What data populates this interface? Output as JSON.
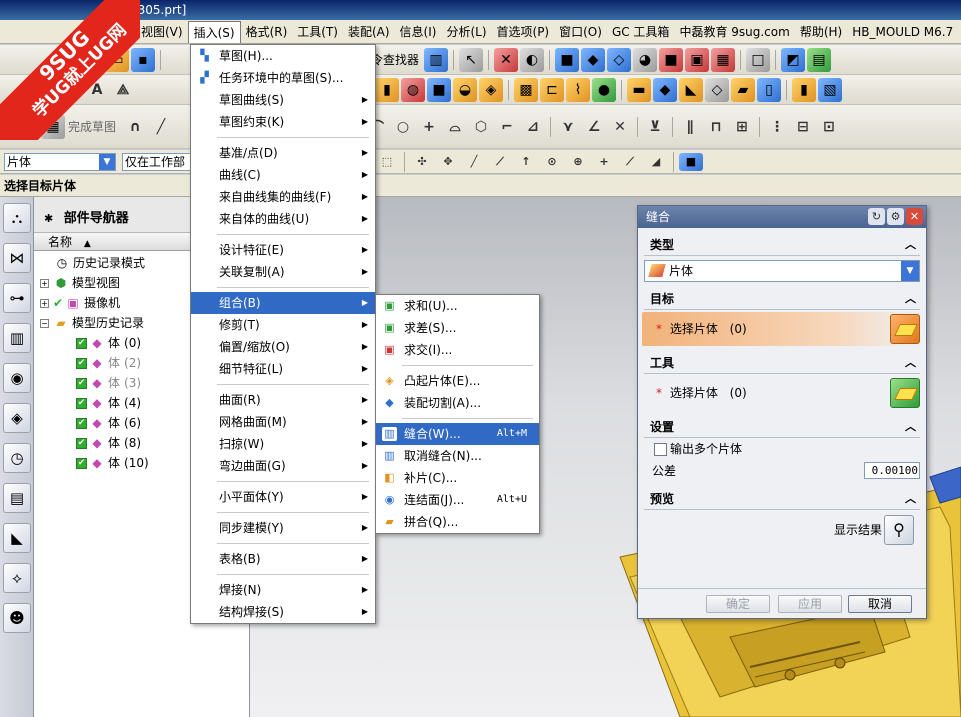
{
  "window": {
    "title_fragment": "0305.prt]"
  },
  "watermark": {
    "line1": "9SUG",
    "line2": "学UG就上UG网"
  },
  "menubar": {
    "items": [
      "视图(V)",
      "插入(S)",
      "格式(R)",
      "工具(T)",
      "装配(A)",
      "信息(I)",
      "分析(L)",
      "首选项(P)",
      "窗口(O)",
      "GC 工具箱",
      "中磊教育 9sug.com",
      "帮助(H)",
      "HB_MOULD M6.7"
    ],
    "active_index": 1
  },
  "toolbar": {
    "finish_sketch": "完成草图",
    "command_finder": "命令查找器"
  },
  "selection_bar": {
    "filter_value": "片体",
    "scope_value": "仅在工作部件"
  },
  "status_prompt": "选择目标片体",
  "navigator": {
    "title": "部件导航器",
    "column": "名称",
    "nodes": [
      {
        "label": "历史记录模式",
        "level": 0
      },
      {
        "label": "模型视图",
        "level": 0
      },
      {
        "label": "摄像机",
        "level": 0
      },
      {
        "label": "模型历史记录",
        "level": 0
      }
    ],
    "bodies": [
      {
        "label": "体",
        "id": "(0)"
      },
      {
        "label": "体",
        "id": "(2)"
      },
      {
        "label": "体",
        "id": "(3)"
      },
      {
        "label": "体",
        "id": "(4)"
      },
      {
        "label": "体",
        "id": "(6)"
      },
      {
        "label": "体",
        "id": "(8)"
      },
      {
        "label": "体",
        "id": "(10)"
      }
    ]
  },
  "insert_menu": {
    "items": [
      {
        "label": "草图(H)...",
        "sub": false
      },
      {
        "label": "任务环境中的草图(S)...",
        "sub": false
      },
      {
        "label": "草图曲线(S)",
        "sub": true
      },
      {
        "label": "草图约束(K)",
        "sub": true
      },
      {
        "sep": true
      },
      {
        "label": "基准/点(D)",
        "sub": true
      },
      {
        "label": "曲线(C)",
        "sub": true
      },
      {
        "label": "来自曲线集的曲线(F)",
        "sub": true
      },
      {
        "label": "来自体的曲线(U)",
        "sub": true
      },
      {
        "sep": true
      },
      {
        "label": "设计特征(E)",
        "sub": true
      },
      {
        "label": "关联复制(A)",
        "sub": true
      },
      {
        "sep": true
      },
      {
        "label": "组合(B)",
        "sub": true,
        "hl": true
      },
      {
        "label": "修剪(T)",
        "sub": true
      },
      {
        "label": "偏置/缩放(O)",
        "sub": true
      },
      {
        "label": "细节特征(L)",
        "sub": true
      },
      {
        "sep": true
      },
      {
        "label": "曲面(R)",
        "sub": true
      },
      {
        "label": "网格曲面(M)",
        "sub": true
      },
      {
        "label": "扫掠(W)",
        "sub": true
      },
      {
        "label": "弯边曲面(G)",
        "sub": true
      },
      {
        "sep": true
      },
      {
        "label": "小平面体(Y)",
        "sub": true
      },
      {
        "sep": true
      },
      {
        "label": "同步建模(Y)",
        "sub": true
      },
      {
        "sep": true
      },
      {
        "label": "表格(B)",
        "sub": true
      },
      {
        "sep": true
      },
      {
        "label": "焊接(N)",
        "sub": true
      },
      {
        "label": "结构焊接(S)",
        "sub": true
      }
    ]
  },
  "combine_menu": {
    "items": [
      {
        "label": "求和(U)...",
        "shortcut": ""
      },
      {
        "label": "求差(S)...",
        "shortcut": ""
      },
      {
        "label": "求交(I)...",
        "shortcut": ""
      },
      {
        "sep": true
      },
      {
        "label": "凸起片体(E)...",
        "shortcut": ""
      },
      {
        "label": "装配切割(A)...",
        "shortcut": ""
      },
      {
        "sep": true
      },
      {
        "label": "缝合(W)...",
        "shortcut": "Alt+M",
        "hl": true
      },
      {
        "label": "取消缝合(N)...",
        "shortcut": ""
      },
      {
        "label": "补片(C)...",
        "shortcut": ""
      },
      {
        "label": "连结面(J)...",
        "shortcut": "Alt+U"
      },
      {
        "label": "拼合(Q)...",
        "shortcut": ""
      }
    ]
  },
  "dialog": {
    "title": "缝合",
    "type_header": "类型",
    "type_value": "片体",
    "target_header": "目标",
    "target_label": "选择片体",
    "target_count": "(0)",
    "tool_header": "工具",
    "tool_label": "选择片体",
    "tool_count": "(0)",
    "settings_header": "设置",
    "multi_body_label": "输出多个片体",
    "tolerance_label": "公差",
    "tolerance_value": "0.00100",
    "preview_header": "预览",
    "show_result_label": "显示结果",
    "ok_label": "确定",
    "apply_label": "应用",
    "cancel_label": "取消"
  }
}
